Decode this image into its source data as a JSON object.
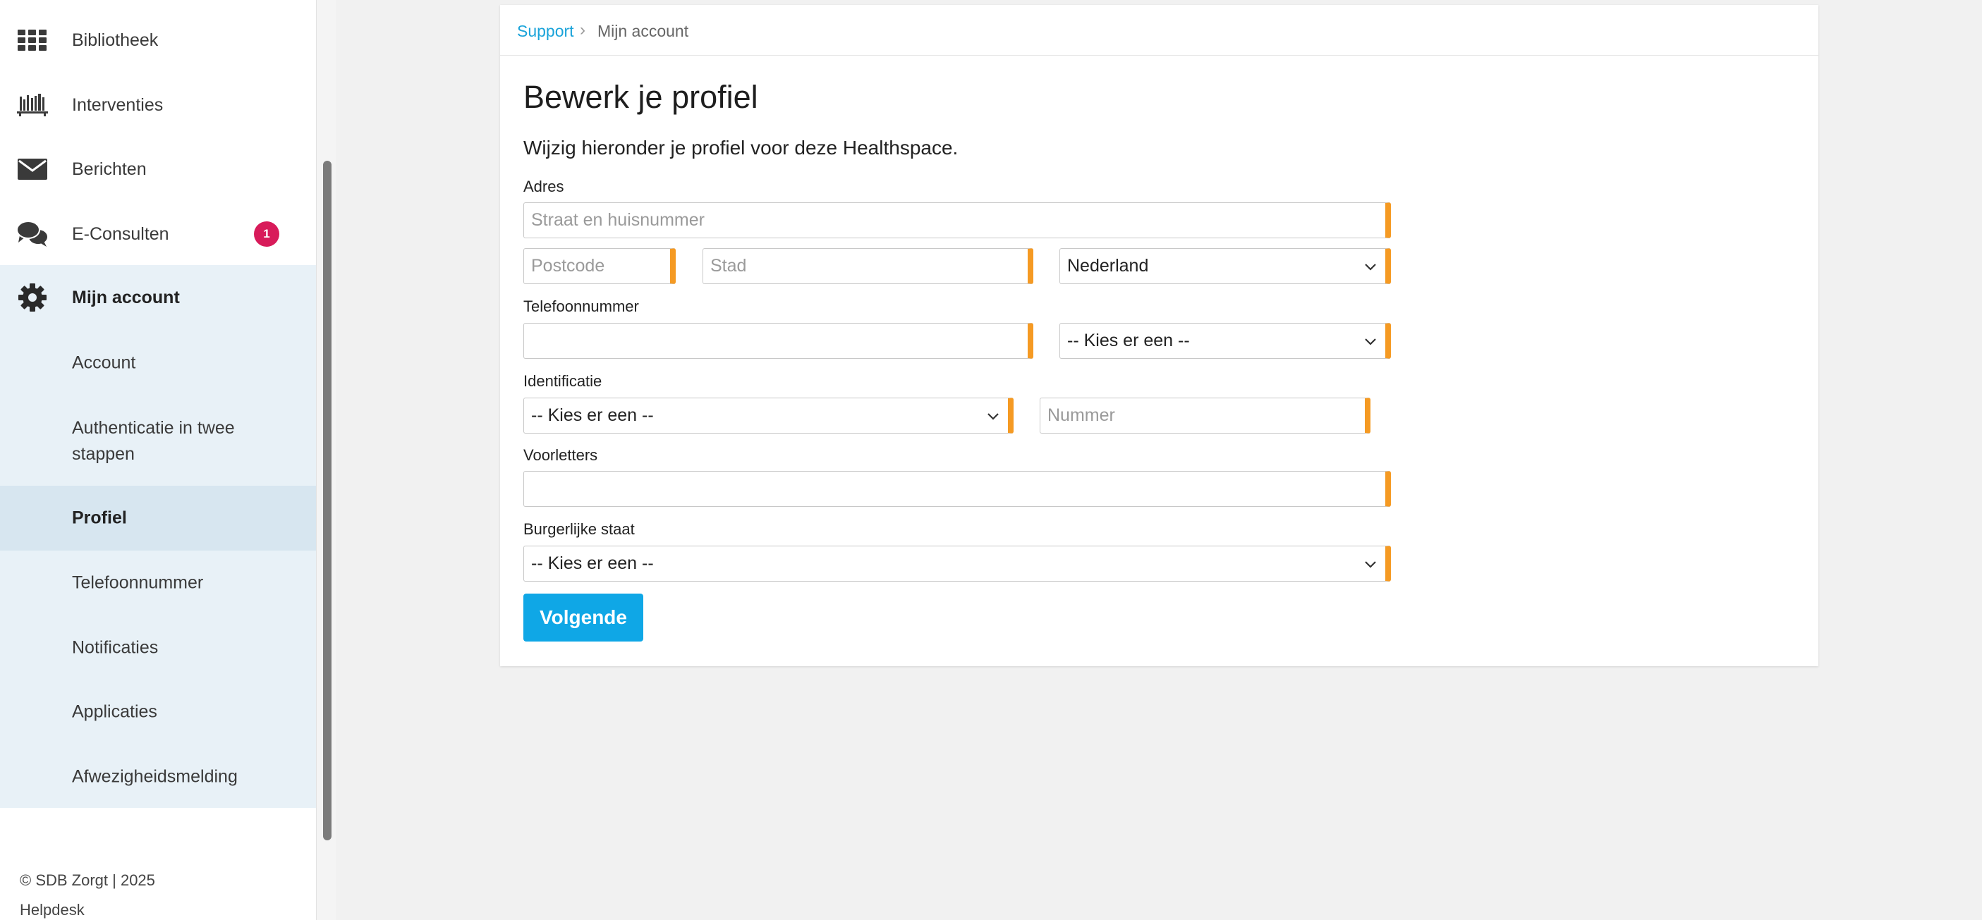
{
  "sidebar": {
    "nav": [
      {
        "label": "Bibliotheek",
        "icon": "grid-icon"
      },
      {
        "label": "Interventies",
        "icon": "bookshelf-icon"
      },
      {
        "label": "Berichten",
        "icon": "envelope-icon"
      },
      {
        "label": "E-Consulten",
        "icon": "chat-bubbles-icon",
        "badge": "1"
      },
      {
        "label": "Mijn account",
        "icon": "gear-icon"
      }
    ],
    "submenu": [
      {
        "label": "Account"
      },
      {
        "label": "Authenticatie in twee stappen"
      },
      {
        "label": "Profiel"
      },
      {
        "label": "Telefoonnummer"
      },
      {
        "label": "Notificaties"
      },
      {
        "label": "Applicaties"
      },
      {
        "label": "Afwezigheidsmelding"
      }
    ],
    "footer_copyright": "© SDB Zorgt | 2025",
    "footer_helpdesk": "Helpdesk"
  },
  "breadcrumb": {
    "link": "Support",
    "separator": "›",
    "current": "Mijn account"
  },
  "page": {
    "title": "Bewerk je profiel",
    "intro": "Wijzig hieronder je profiel voor deze Healthspace."
  },
  "form": {
    "address_label": "Adres",
    "street_placeholder": "Straat en huisnummer",
    "postcode_placeholder": "Postcode",
    "city_placeholder": "Stad",
    "country_value": "Nederland",
    "phone_label": "Telefoonnummer",
    "phone_type_value": "-- Kies er een --",
    "identification_label": "Identificatie",
    "id_type_value": "-- Kies er een --",
    "id_number_placeholder": "Nummer",
    "initials_label": "Voorletters",
    "marital_label": "Burgerlijke staat",
    "marital_value": "-- Kies er een --",
    "submit_label": "Volgende"
  },
  "colors": {
    "accent": "#0fa7e6",
    "required_marker": "#f59a23",
    "badge": "#d81b5a",
    "submenu_bg": "#e8f1f7"
  }
}
